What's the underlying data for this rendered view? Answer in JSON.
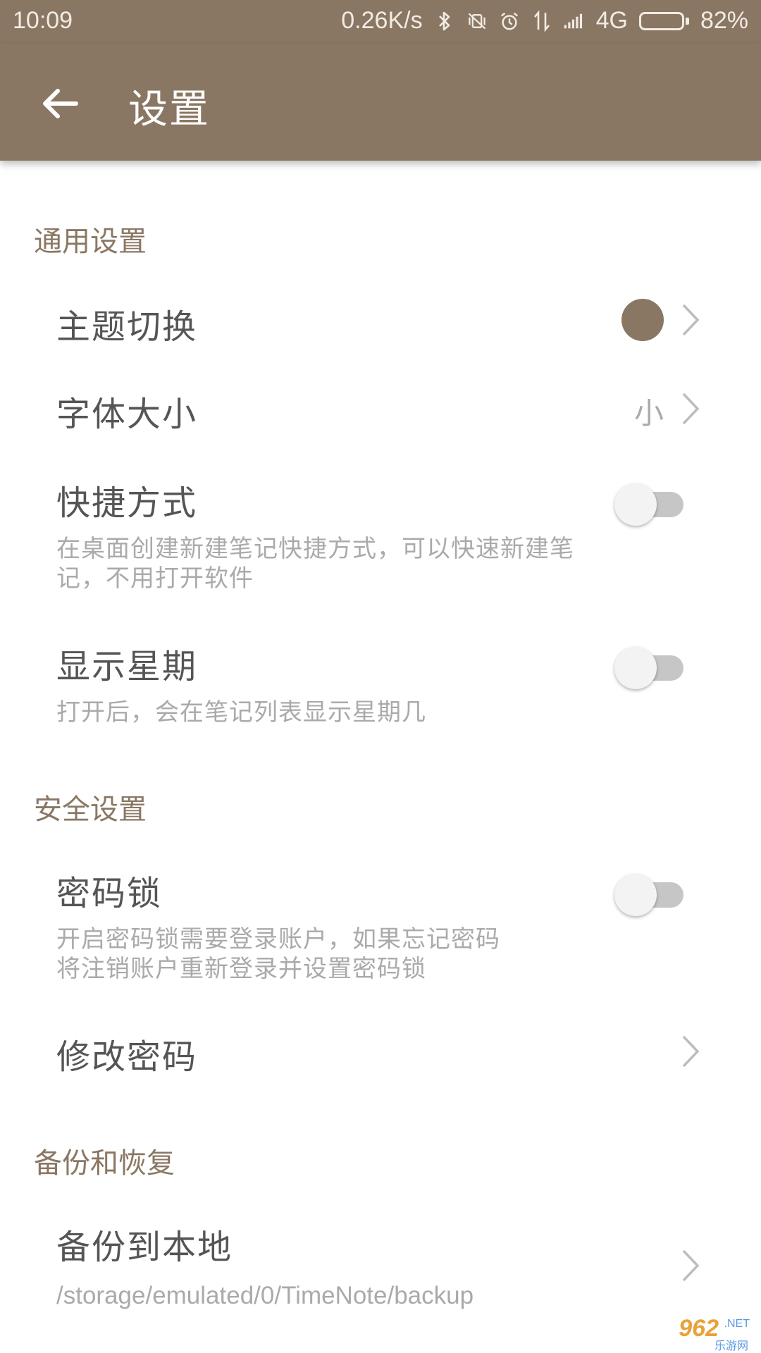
{
  "status_bar": {
    "time": "10:09",
    "net_speed": "0.26K/s",
    "network": "4G",
    "battery": "82%",
    "battery_level": 0.82,
    "icons": [
      "bluetooth-icon",
      "vibrate-off-icon",
      "alarm-icon",
      "data-transfer-icon",
      "signal-icon",
      "battery-icon"
    ]
  },
  "app_bar": {
    "title": "设置",
    "back_icon": "arrow-left-icon"
  },
  "colors": {
    "primary": "#8a7763",
    "theme_swatch": "#8a7763",
    "switch_track_off": "#c6c6c6"
  },
  "sections": {
    "general": {
      "header": "通用设置",
      "theme": {
        "title": "主题切换"
      },
      "font_size": {
        "title": "字体大小",
        "value": "小"
      },
      "shortcut": {
        "title": "快捷方式",
        "subtitle_line1": "在桌面创建新建笔记快捷方式，可以快速新建笔",
        "subtitle_line2": "记，不用打开软件",
        "enabled": false
      },
      "show_weekday": {
        "title": "显示星期",
        "subtitle": "打开后，会在笔记列表显示星期几",
        "enabled": false
      }
    },
    "security": {
      "header": "安全设置",
      "password_lock": {
        "title": "密码锁",
        "subtitle_line1": "开启密码锁需要登录账户，如果忘记密码",
        "subtitle_line2": "将注销账户重新登录并设置密码锁",
        "enabled": false
      },
      "change_password": {
        "title": "修改密码"
      }
    },
    "backup": {
      "header": "备份和恢复",
      "backup_local": {
        "title": "备份到本地",
        "path": "/storage/emulated/0/TimeNote/backup"
      }
    }
  },
  "watermark": {
    "main": "962",
    "net": ".NET",
    "sub": "乐游网"
  }
}
